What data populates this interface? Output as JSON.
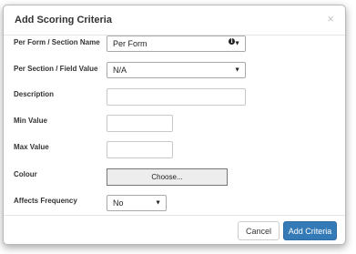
{
  "modal": {
    "title": "Add Scoring Criteria",
    "close_glyph": "×"
  },
  "fields": {
    "per_form_label": "Per Form / Section Name",
    "per_form_value": "Per Form",
    "info_glyph": "i",
    "per_section_label": "Per Section / Field Value",
    "per_section_value": "N/A",
    "description_label": "Description",
    "description_value": "",
    "min_label": "Min Value",
    "min_value": "",
    "max_label": "Max Value",
    "max_value": "",
    "colour_label": "Colour",
    "colour_button": "Choose...",
    "frequency_label": "Affects Frequency",
    "frequency_value": "No"
  },
  "footer": {
    "cancel_label": "Cancel",
    "add_label": "Add Criteria"
  },
  "icons": {
    "dropdown": "chevron-down-icon",
    "info": "info-icon",
    "close": "close-icon"
  },
  "colors": {
    "primary": "#337ab7",
    "primary_border": "#2e6da4"
  }
}
